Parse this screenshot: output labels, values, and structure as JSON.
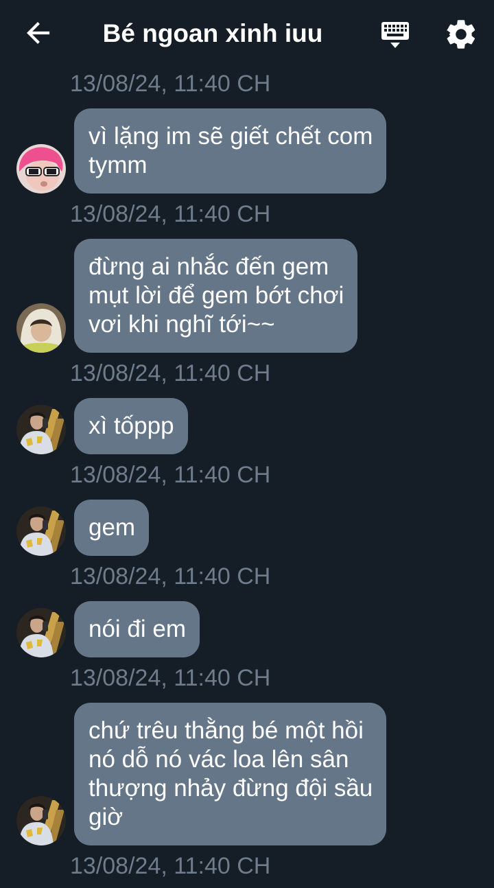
{
  "header": {
    "title": "Bé ngoan xinh iuu",
    "back_icon": "arrow-left-icon",
    "keyboard_icon": "keyboard-icon",
    "settings_icon": "gear-icon"
  },
  "colors": {
    "background": "#151d27",
    "bubble": "#667689",
    "timestamp": "#6f7c8c"
  },
  "messages": [
    {
      "timestamp": "13/08/24, 11:40 CH",
      "lines": [
        "vì lặng im sẽ giết chết com",
        "tymm"
      ],
      "avatar": "pink-hair-avatar"
    },
    {
      "timestamp": "13/08/24, 11:40 CH",
      "lines": [
        "đừng ai nhắc đến gem",
        "mụt lời để gem bớt chơi",
        "vơi khi nghĩ tới~~"
      ],
      "avatar": "hooded-avatar"
    },
    {
      "timestamp": "13/08/24, 11:40 CH",
      "lines": [
        "xì tốppp"
      ],
      "avatar": "mirror-selfie-avatar"
    },
    {
      "timestamp": "13/08/24, 11:40 CH",
      "lines": [
        "gem"
      ],
      "avatar": "mirror-selfie-avatar"
    },
    {
      "timestamp": "13/08/24, 11:40 CH",
      "lines": [
        "nói đi em"
      ],
      "avatar": "mirror-selfie-avatar"
    },
    {
      "timestamp": "13/08/24, 11:40 CH",
      "lines": [
        "chứ trêu thằng bé một hồi",
        "nó dỗ nó vác loa lên sân",
        "thượng nhảy đừng đội sầu",
        "giờ"
      ],
      "avatar": "mirror-selfie-avatar"
    }
  ],
  "trailing_timestamp": "13/08/24, 11:40 CH"
}
